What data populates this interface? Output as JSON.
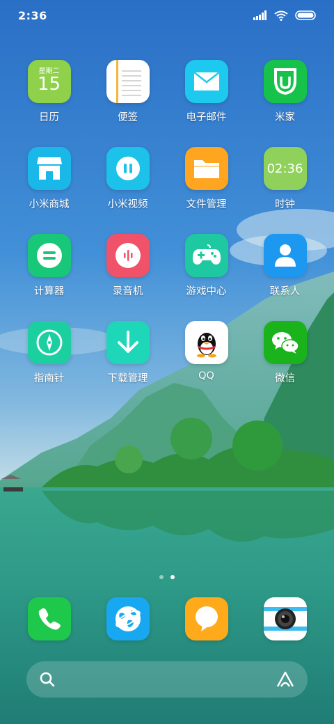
{
  "status": {
    "time": "2:36"
  },
  "apps": [
    {
      "label": "日历",
      "icon": "calendar-icon",
      "color": "#8fd14b",
      "weekday": "星期二",
      "day": "15"
    },
    {
      "label": "便签",
      "icon": "notes-icon",
      "color": "#ffffff"
    },
    {
      "label": "电子邮件",
      "icon": "mail-icon",
      "color": "#1ec9f0"
    },
    {
      "label": "米家",
      "icon": "mijia-icon",
      "color": "#17c24a"
    },
    {
      "label": "小米商城",
      "icon": "store-icon",
      "color": "#1ab8e8"
    },
    {
      "label": "小米视频",
      "icon": "video-icon",
      "color": "#1cc2ea"
    },
    {
      "label": "文件管理",
      "icon": "folder-icon",
      "color": "#ffa51f"
    },
    {
      "label": "时钟",
      "icon": "clock-icon",
      "color": "#8fd15a",
      "clock": "02:36"
    },
    {
      "label": "计算器",
      "icon": "calculator-icon",
      "color": "#18c878"
    },
    {
      "label": "录音机",
      "icon": "recorder-icon",
      "color": "#f0526a"
    },
    {
      "label": "游戏中心",
      "icon": "gamepad-icon",
      "color": "#1ec8a0"
    },
    {
      "label": "联系人",
      "icon": "contacts-icon",
      "color": "#1c98f0"
    },
    {
      "label": "指南针",
      "icon": "compass-icon",
      "color": "#1ccfa0"
    },
    {
      "label": "下载管理",
      "icon": "download-icon",
      "color": "#1ed6b8"
    },
    {
      "label": "QQ",
      "icon": "qq-icon",
      "color": "#ffffff"
    },
    {
      "label": "微信",
      "icon": "wechat-icon",
      "color": "#1bb31c"
    }
  ],
  "dock": [
    {
      "icon": "phone-icon",
      "color": "#1ec84a"
    },
    {
      "icon": "browser-icon",
      "color": "#18a8f2"
    },
    {
      "icon": "messages-icon",
      "color": "#ffaa1a"
    },
    {
      "icon": "camera-icon",
      "color": "#ffffff"
    }
  ]
}
